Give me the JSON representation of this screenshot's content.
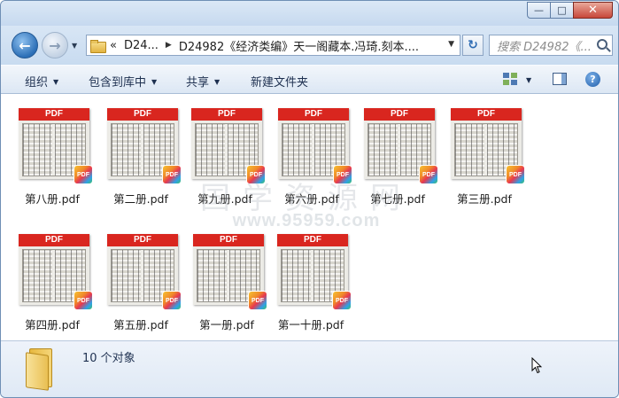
{
  "window": {
    "controls": {
      "minimize": "—",
      "maximize": "□",
      "close": "✕"
    }
  },
  "nav": {
    "back_glyph": "←",
    "forward_glyph": "→",
    "history_caret": "▼",
    "breadcrumb": {
      "overflow": "«",
      "root": "D24...",
      "current": "D24982《经济类编》天一阁藏本.冯琦.刻本...."
    },
    "refresh_glyph": "↻",
    "search_placeholder": "搜索 D24982《..."
  },
  "toolbar": {
    "organize": "组织",
    "include_in_library": "包含到库中",
    "share": "共享",
    "new_folder": "新建文件夹",
    "help": "?"
  },
  "files": [
    {
      "name": "第八册.pdf"
    },
    {
      "name": "第二册.pdf"
    },
    {
      "name": "第九册.pdf"
    },
    {
      "name": "第六册.pdf"
    },
    {
      "name": "第七册.pdf"
    },
    {
      "name": "第三册.pdf"
    },
    {
      "name": "第四册.pdf"
    },
    {
      "name": "第五册.pdf"
    },
    {
      "name": "第一册.pdf"
    },
    {
      "name": "第一十册.pdf"
    }
  ],
  "thumb_band_label": "PDF",
  "thumb_badge_label": "PDF",
  "watermark": {
    "text_cn": "国学资源网",
    "text_url": "www.95959.com"
  },
  "status": {
    "item_count": "10 个对象"
  },
  "colors": {
    "pdf_band": "#d9261f",
    "accent": "#2c6fb7"
  }
}
